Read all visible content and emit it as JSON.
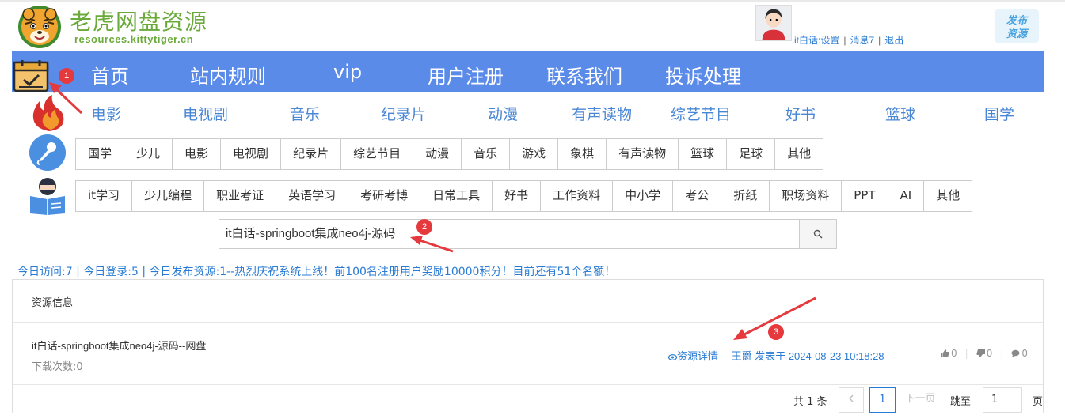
{
  "header": {
    "site_title": "老虎网盘资源",
    "site_subtitle": "resources.kittytiger.cn",
    "user_name_settings": "it白话:设置",
    "messages": "消息7",
    "logout": "退出",
    "publish_line1": "发布",
    "publish_line2": "资源"
  },
  "nav": {
    "items": [
      "首页",
      "站内规则",
      "vip",
      "用户注册",
      "联系我们",
      "投诉处理"
    ]
  },
  "categories": [
    "电影",
    "电视剧",
    "音乐",
    "纪录片",
    "动漫",
    "有声读物",
    "综艺节目",
    "好书",
    "篮球",
    "国学"
  ],
  "tags_row1": [
    "国学",
    "少儿",
    "电影",
    "电视剧",
    "纪录片",
    "综艺节目",
    "动漫",
    "音乐",
    "游戏",
    "象棋",
    "有声读物",
    "篮球",
    "足球",
    "其他"
  ],
  "tags_row2": [
    "it学习",
    "少儿编程",
    "职业考证",
    "英语学习",
    "考研考博",
    "日常工具",
    "好书",
    "工作资料",
    "中小学",
    "考公",
    "折纸",
    "职场资料",
    "PPT",
    "AI",
    "其他"
  ],
  "search": {
    "value": "it白话-springboot集成neo4j-源码"
  },
  "stats": "今日访问:7 | 今日登录:5 | 今日发布资源:1--热烈庆祝系统上线！前100名注册用户奖励10000积分！目前还有51个名额！",
  "panel": {
    "title": "资源信息",
    "resource": {
      "title": "it白话-springboot集成neo4j-源码--网盘",
      "downloads": "下载次数:0",
      "meta": "资源详情--- 王爵 发表于 2024-08-23 10:18:28",
      "likes": "0",
      "dislikes": "0",
      "comments": "0"
    },
    "pager": {
      "total": "共 1 条",
      "current": "1",
      "next": "下一页",
      "goto": "跳至",
      "input": "1",
      "unit": "页"
    }
  },
  "annotations": {
    "badge1": "1",
    "badge2": "2",
    "badge3": "3"
  },
  "colors": {
    "nav_bg": "#5b8be8",
    "link": "#2a7bd4",
    "accent_red": "#e5393d",
    "brand_green": "#6aaa3a"
  }
}
